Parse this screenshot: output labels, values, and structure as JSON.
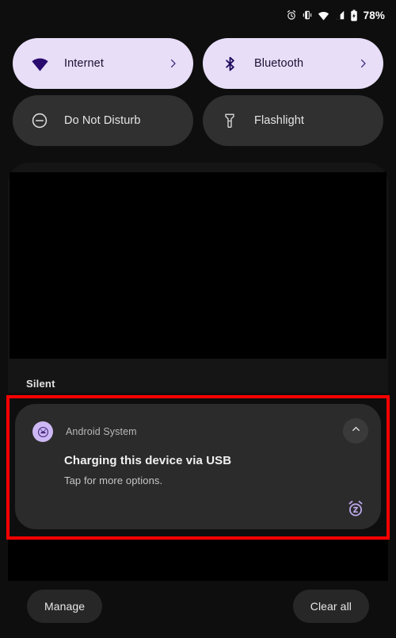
{
  "status_bar": {
    "icons": [
      "alarm-icon",
      "vibrate-icon",
      "wifi-icon",
      "cellular-signal-icon",
      "battery-icon"
    ],
    "battery_percent": "78%"
  },
  "quick_settings": {
    "tiles": [
      {
        "label": "Internet",
        "icon": "wifi-icon",
        "state": "on",
        "has_chevron": true,
        "chevron": "chevron-right-icon"
      },
      {
        "label": "Bluetooth",
        "icon": "bluetooth-icon",
        "state": "on",
        "has_chevron": true,
        "chevron": "chevron-right-icon"
      },
      {
        "label": "Do Not Disturb",
        "icon": "do-not-disturb-icon",
        "state": "off",
        "has_chevron": false,
        "chevron": ""
      },
      {
        "label": "Flashlight",
        "icon": "flashlight-icon",
        "state": "off",
        "has_chevron": false,
        "chevron": ""
      }
    ]
  },
  "notifications": {
    "section_label": "Silent",
    "items": [
      {
        "app_name": "Android System",
        "app_icon": "android-system-icon",
        "title": "Charging this device via USB",
        "body": "Tap for more options.",
        "expand_icon": "chevron-up-icon",
        "snooze_icon": "snooze-alarm-icon",
        "highlighted": true
      }
    ]
  },
  "footer": {
    "manage_label": "Manage",
    "clear_all_label": "Clear all"
  },
  "colors": {
    "background": "#0e0e0e",
    "tile_on_bg": "#e8def8",
    "tile_on_fg": "#1b1033",
    "tile_off_bg": "#303030",
    "tile_off_fg": "#e6e6e6",
    "notification_bg": "#2b2b2b",
    "highlight_border": "#ff0000",
    "accent_purple": "#b9a6e8",
    "avatar_bg": "#cdb8f5"
  }
}
